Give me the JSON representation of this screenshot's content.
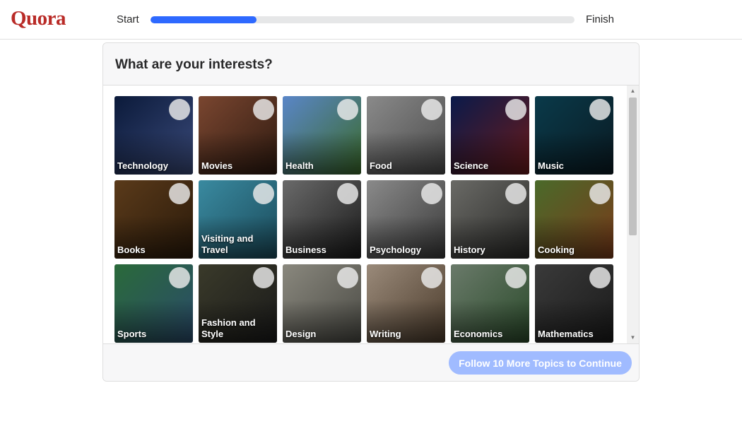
{
  "brand": {
    "logo_text": "Quora",
    "logo_color": "#b92b27"
  },
  "progress": {
    "start_label": "Start",
    "finish_label": "Finish",
    "fraction": 0.25,
    "fill_color": "#2e69ff"
  },
  "modal": {
    "title": "What are your interests?",
    "topics": [
      {
        "label": "Technology",
        "icon": "technology-image",
        "c1": "#0b1a3a",
        "c2": "#3a4a7a"
      },
      {
        "label": "Movies",
        "icon": "movies-image",
        "c1": "#7a4630",
        "c2": "#2e1a10"
      },
      {
        "label": "Health",
        "icon": "health-image",
        "c1": "#5a86c8",
        "c2": "#3a6a2a"
      },
      {
        "label": "Food",
        "icon": "food-image",
        "c1": "#8a8a8a",
        "c2": "#4a4a4a"
      },
      {
        "label": "Science",
        "icon": "science-image",
        "c1": "#0a1a4a",
        "c2": "#6a1a1a"
      },
      {
        "label": "Music",
        "icon": "music-image",
        "c1": "#0a3a4a",
        "c2": "#0a1a22"
      },
      {
        "label": "Books",
        "icon": "books-image",
        "c1": "#5a3a1a",
        "c2": "#2a1a0a"
      },
      {
        "label": "Visiting and Travel",
        "icon": "travel-image",
        "c1": "#3a8aa0",
        "c2": "#1a4a5a"
      },
      {
        "label": "Business",
        "icon": "business-image",
        "c1": "#6a6a6a",
        "c2": "#1a1a1a"
      },
      {
        "label": "Psychology",
        "icon": "psychology-image",
        "c1": "#8a8a8a",
        "c2": "#3a3a3a"
      },
      {
        "label": "History",
        "icon": "history-image",
        "c1": "#6a6a66",
        "c2": "#2a2a28"
      },
      {
        "label": "Cooking",
        "icon": "cooking-image",
        "c1": "#4a6a2a",
        "c2": "#7a3a1a"
      },
      {
        "label": "Sports",
        "icon": "sports-image",
        "c1": "#2a6a3a",
        "c2": "#2a4a6a"
      },
      {
        "label": "Fashion and Style",
        "icon": "fashion-image",
        "c1": "#3a3a2a",
        "c2": "#1a1a1a"
      },
      {
        "label": "Design",
        "icon": "design-image",
        "c1": "#8a887e",
        "c2": "#4a4a44"
      },
      {
        "label": "Writing",
        "icon": "writing-image",
        "c1": "#9a8a7a",
        "c2": "#4a3a2a"
      },
      {
        "label": "Economics",
        "icon": "economics-image",
        "c1": "#6a7a6a",
        "c2": "#2a4a2a"
      },
      {
        "label": "Mathematics",
        "icon": "mathematics-image",
        "c1": "#3a3a3a",
        "c2": "#1a1a1a"
      }
    ],
    "continue_label": "Follow 10 More Topics to Continue",
    "continue_color": "#a0bbff"
  }
}
